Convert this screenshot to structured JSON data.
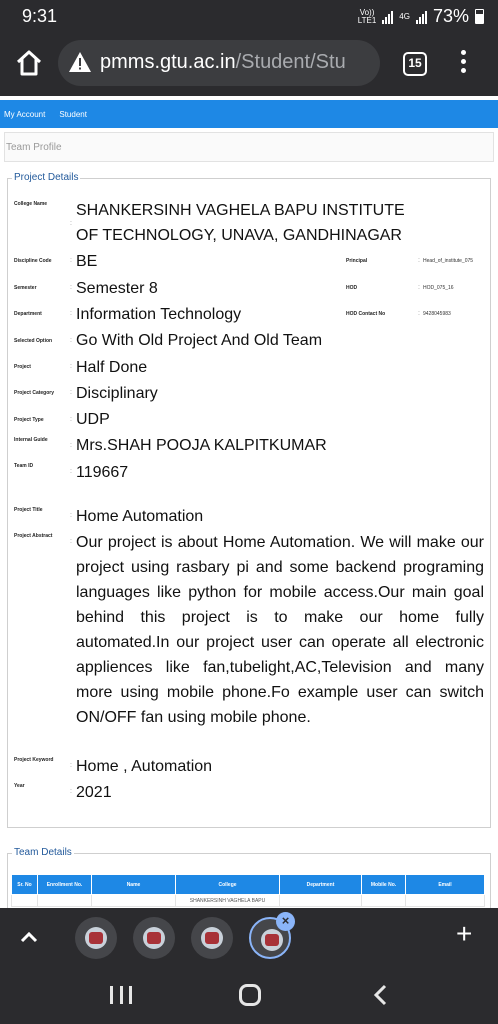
{
  "status_bar": {
    "time": "9:31",
    "net_top": "Vo))",
    "net_bottom": "LTE1",
    "gen": "4G",
    "battery": "73%"
  },
  "browser": {
    "url_domain": "pmms.gtu.ac.in",
    "url_path": "/Student/Stu",
    "tab_count": "15"
  },
  "nav": {
    "items": [
      "My Account",
      "Student"
    ]
  },
  "breadcrumb": "Team Profile",
  "project_details": {
    "legend": "Project Details",
    "college_name_label": "College Name",
    "college_name_line1": "SHANKERSINH VAGHELA BAPU INSTITUTE",
    "college_name_line2": "OF TECHNOLOGY, UNAVA, GANDHINAGAR",
    "discipline_code_label": "Discipline Code",
    "discipline_code": "BE",
    "principal_label": "Principal",
    "principal": "Head_of_institute_075",
    "semester_label": "Semester",
    "semester": "Semester 8",
    "hod_label": "HOD",
    "hod": "HOD_075_16",
    "department_label": "Department",
    "department": "Information Technology",
    "hod_contact_label": "HOD Contact No",
    "hod_contact": "9428045983",
    "selected_option_label": "Selected Option",
    "selected_option": "Go With Old Project And Old Team",
    "project_label": "Project",
    "project": "Half Done",
    "project_category_label": "Project Category",
    "project_category": "Disciplinary",
    "project_type_label": "Project Type",
    "project_type": "UDP",
    "internal_guide_label": "Internal Guide",
    "internal_guide": "Mrs.SHAH POOJA KALPITKUMAR",
    "team_id_label": "Team ID",
    "team_id": "119667",
    "project_title_label": "Project Title",
    "project_title": "Home Automation",
    "project_abstract_label": "Project Abstract",
    "project_abstract": "Our project is about Home Automation. We will make our project using rasbary pi and some backend programing languages like python for mobile access.Our main goal behind this project is to make our home fully automated.In our project user can operate all electronic appliences like fan,tubelight,AC,Television and many more using mobile phone.Fo example user can switch ON/OFF fan using mobile phone.",
    "project_keyword_label": "Project Keyword",
    "project_keyword": "Home , Automation",
    "year_label": "Year",
    "year": "2021"
  },
  "team_details": {
    "legend": "Team Details",
    "columns": [
      "Sr. No",
      "Enrollment No.",
      "Name",
      "College",
      "Department",
      "Mobile No.",
      "Email"
    ],
    "first_row_college": "SHANKERSINH VAGHELA BAPU"
  },
  "colors": {
    "nav_blue": "#1e88e5",
    "chrome_dark": "#2b2b2e",
    "legend_blue": "#235a9b"
  },
  "icons": [
    "home-icon",
    "warning-icon",
    "menu-icon",
    "chevron-up-icon",
    "plus-icon",
    "recents-icon",
    "home-nav-icon",
    "back-icon"
  ]
}
